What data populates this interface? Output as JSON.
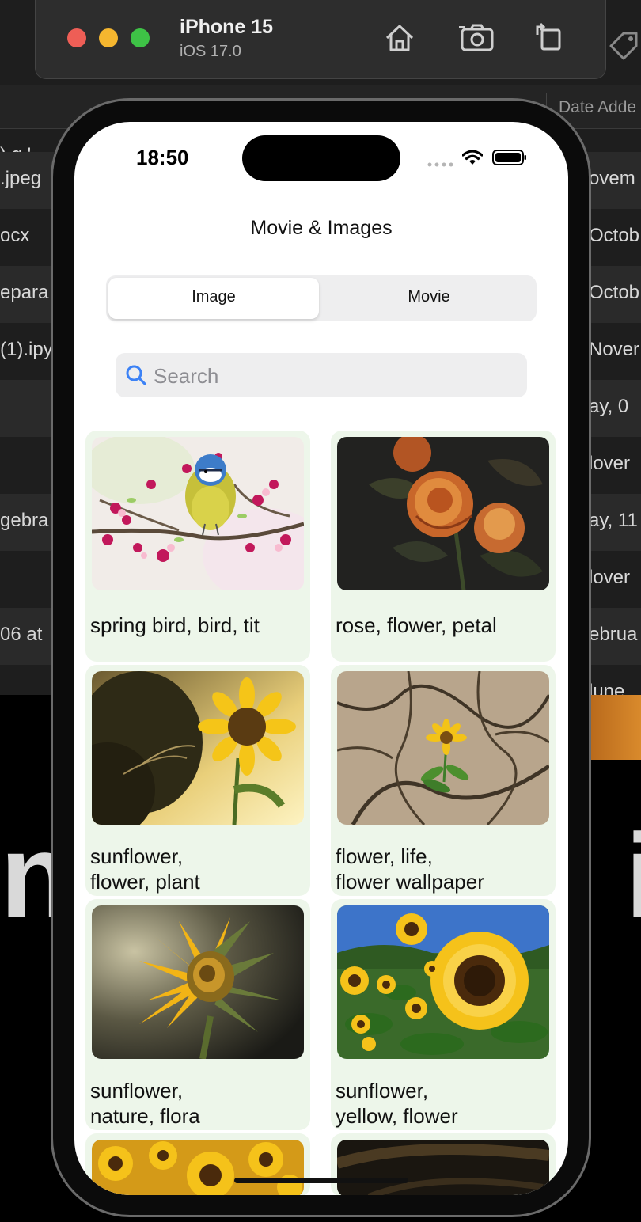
{
  "simulator": {
    "device_name": "iPhone 15",
    "os_version": "iOS 17.0",
    "traffic_lights": [
      "#ee5e56",
      "#f5b62f",
      "#3ec246"
    ],
    "icons": [
      "home-icon",
      "screenshot-icon",
      "rotate-icon",
      "tag-icon"
    ]
  },
  "background_window": {
    "column_header": "Date Adde",
    "rows": [
      {
        "left": ").g '",
        "right": ""
      },
      {
        "left": ".jpeg",
        "right": "ovem"
      },
      {
        "left": "ocx",
        "right": "Octob"
      },
      {
        "left": "epara",
        "right": "Octob"
      },
      {
        "left": "(1).ipy",
        "right": "Nover"
      },
      {
        "left": "",
        "right": "ay, 0"
      },
      {
        "left": "",
        "right": "lover"
      },
      {
        "left": "gebra",
        "right": "ay, 11"
      },
      {
        "left": "",
        "right": "lover"
      },
      {
        "left": "06 at",
        "right": "ebrua"
      },
      {
        "left": "",
        "right": "lune "
      }
    ],
    "big_text_left": "n",
    "big_text_right": "i"
  },
  "status_bar": {
    "time": "18:50"
  },
  "nav": {
    "title": "Movie & Images"
  },
  "segmented_control": {
    "options": [
      "Image",
      "Movie"
    ],
    "selected": "Image"
  },
  "search": {
    "placeholder": "Search"
  },
  "cards": [
    {
      "label": "spring bird, bird, tit"
    },
    {
      "label": "rose, flower, petal"
    },
    {
      "label": "sunflower,\nflower, plant"
    },
    {
      "label": "flower, life,\nflower wallpaper"
    },
    {
      "label": "sunflower,\nnature, flora"
    },
    {
      "label": "sunflower,\nyellow, flower"
    },
    {
      "label": ""
    },
    {
      "label": ""
    }
  ],
  "colors": {
    "card_background": "#edf6ea",
    "accent": "#007aff"
  }
}
